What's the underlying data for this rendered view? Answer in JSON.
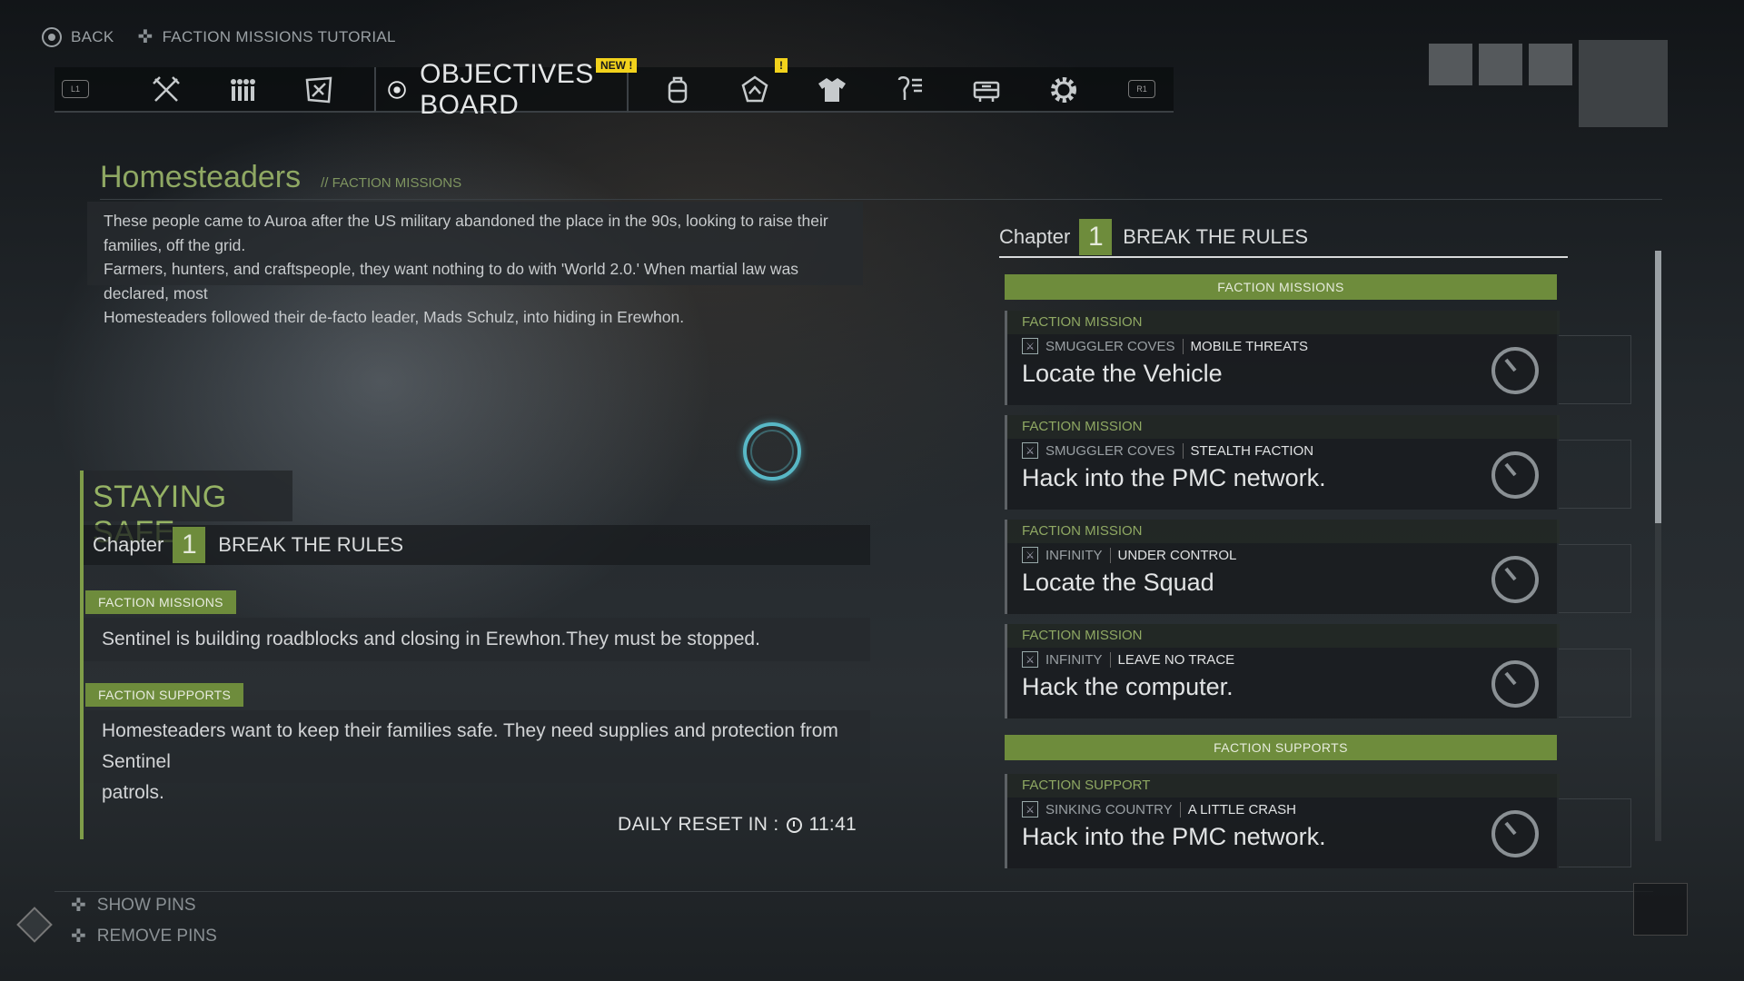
{
  "top_controls": {
    "back_label": "BACK",
    "tutorial_label": "FACTION MISSIONS TUTORIAL"
  },
  "nav": {
    "left_bumper": "L1",
    "right_bumper": "R1",
    "active_tab": "OBJECTIVES BOARD",
    "new_badge": "NEW !",
    "alert_badge": "!",
    "tabs": [
      "weapons-icon",
      "team-icon",
      "faction-icon",
      "objectives-icon",
      "backpack-icon",
      "class-icon",
      "outfit-icon",
      "skills-icon",
      "vehicle-icon",
      "settings-icon"
    ]
  },
  "faction": {
    "name": "Homesteaders",
    "subtitle": "// FACTION MISSIONS",
    "description_lines": [
      "These people came to Auroa after the US military abandoned the place in the 90s, looking to raise their families, off the grid.",
      "Farmers, hunters, and craftspeople, they want nothing to do with 'World 2.0.' When martial law was declared, most",
      "Homesteaders followed their de-facto leader, Mads Schulz, into hiding in Erewhon."
    ]
  },
  "staying_safe": {
    "title": "STAYING SAFE",
    "chapter_label": "Chapter",
    "chapter_number": "1",
    "chapter_name": "BREAK THE RULES",
    "missions_tag": "FACTION MISSIONS",
    "missions_text": "Sentinel is building roadblocks and closing in Erewhon.They must be stopped.",
    "supports_tag": "FACTION SUPPORTS",
    "supports_text_1": "Homesteaders want to keep their families safe. They need supplies and protection from Sentinel",
    "supports_text_2": "patrols."
  },
  "daily_reset": {
    "label": "DAILY RESET IN :",
    "time": "11:41"
  },
  "right_panel": {
    "chapter_label": "Chapter",
    "chapter_number": "1",
    "chapter_name": "BREAK THE RULES",
    "missions_header": "FACTION MISSIONS",
    "supports_header": "FACTION SUPPORTS",
    "missions": [
      {
        "type": "FACTION MISSION",
        "location": "SMUGGLER COVES",
        "operation": "MOBILE THREATS",
        "name": "Locate the Vehicle"
      },
      {
        "type": "FACTION MISSION",
        "location": "SMUGGLER COVES",
        "operation": "STEALTH FACTION",
        "name": "Hack into the PMC network."
      },
      {
        "type": "FACTION MISSION",
        "location": "INFINITY",
        "operation": "UNDER CONTROL",
        "name": "Locate the Squad"
      },
      {
        "type": "FACTION MISSION",
        "location": "INFINITY",
        "operation": "LEAVE NO TRACE",
        "name": "Hack the computer."
      }
    ],
    "supports": [
      {
        "type": "FACTION SUPPORT",
        "location": "SINKING COUNTRY",
        "operation": "A LITTLE CRASH",
        "name": "Hack into the PMC network."
      }
    ]
  },
  "bottom": {
    "show_pins": "SHOW PINS",
    "remove_pins": "REMOVE PINS"
  },
  "colors": {
    "accent_green": "#6e8c3c",
    "title_green": "#8fa863",
    "badge_yellow": "#f2d21c",
    "spinner_cyan": "#58b8c6"
  }
}
